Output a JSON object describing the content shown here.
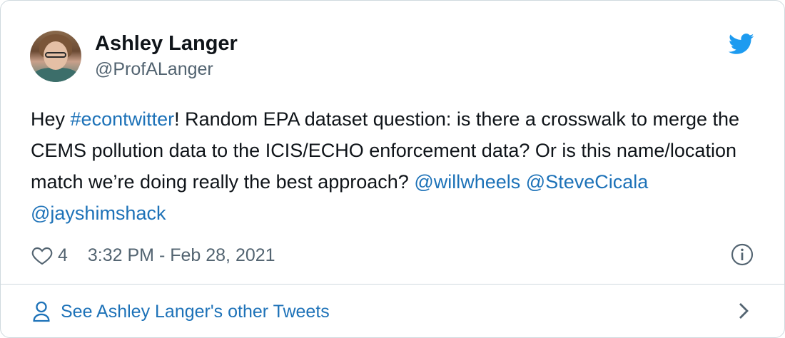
{
  "author": {
    "name": "Ashley Langer",
    "handle": "@ProfALanger"
  },
  "tweet": {
    "part1": "Hey ",
    "hashtag": "#econtwitter",
    "part2": "! Random EPA dataset question: is there a crosswalk to merge the CEMS pollution data to the ICIS/ECHO enforcement data? Or is this name/location match we’re doing really the best approach? ",
    "mention1": "@willwheels",
    "mention2": "@SteveCicala",
    "mention3": "@jayshimshack"
  },
  "meta": {
    "likes": "4",
    "timestamp": "3:32 PM - Feb 28, 2021"
  },
  "footer": {
    "label": "See Ashley Langer's other Tweets"
  },
  "colors": {
    "link": "#1d72b8",
    "twitter_blue": "#1d9bf0",
    "muted": "#536471",
    "border": "#cfd9de"
  },
  "icons": [
    "twitter-bird-icon",
    "heart-icon",
    "info-icon",
    "person-icon",
    "chevron-right-icon"
  ]
}
